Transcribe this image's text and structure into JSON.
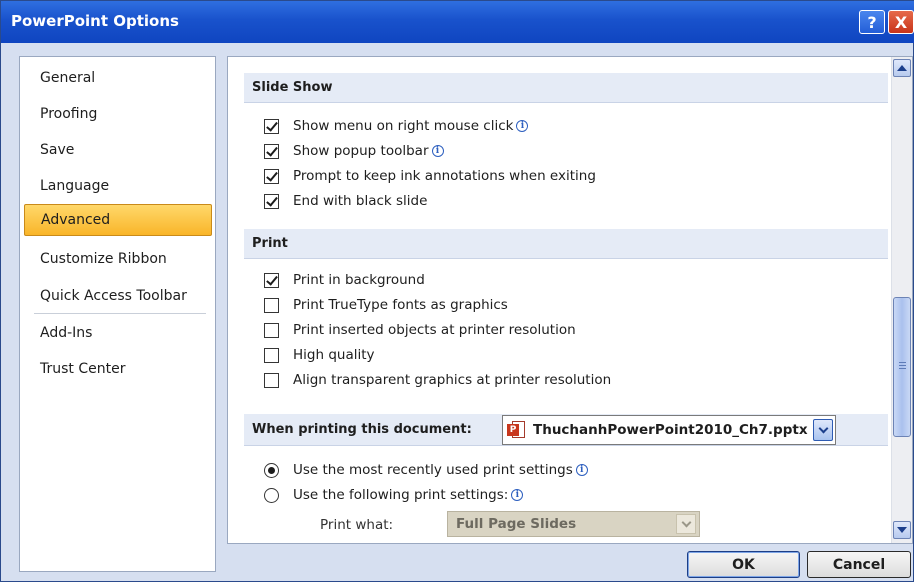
{
  "window": {
    "title": "PowerPoint Options",
    "help_label": "?",
    "close_label": "X"
  },
  "nav": {
    "items": [
      {
        "label": "General"
      },
      {
        "label": "Proofing"
      },
      {
        "label": "Save"
      },
      {
        "label": "Language"
      },
      {
        "label": "Advanced",
        "active": true
      },
      {
        "label": "Customize Ribbon"
      },
      {
        "label": "Quick Access Toolbar"
      },
      {
        "label": "Add-Ins"
      },
      {
        "label": "Trust Center"
      }
    ]
  },
  "slide_show": {
    "header": "Slide Show",
    "options": [
      {
        "label": "Show menu on right mouse click",
        "checked": true,
        "info": true
      },
      {
        "label": "Show popup toolbar",
        "checked": true,
        "info": true
      },
      {
        "label": "Prompt to keep ink annotations when exiting",
        "checked": true,
        "info": false
      },
      {
        "label": "End with black slide",
        "checked": true,
        "info": false
      }
    ]
  },
  "print": {
    "header": "Print",
    "options": [
      {
        "label": "Print in background",
        "checked": true
      },
      {
        "label": "Print TrueType fonts as graphics",
        "checked": false
      },
      {
        "label": "Print inserted objects at printer resolution",
        "checked": false
      },
      {
        "label": "High quality",
        "checked": false
      },
      {
        "label": "Align transparent graphics at printer resolution",
        "checked": false
      }
    ]
  },
  "printing_doc": {
    "header": "When printing this document:",
    "document": "ThuchanhPowerPoint2010_Ch7.pptx",
    "radios": [
      {
        "label": "Use the most recently used print settings",
        "selected": true
      },
      {
        "label": "Use the following print settings:",
        "selected": false
      }
    ],
    "print_what_label": "Print what:",
    "print_what_value": "Full Page Slides"
  },
  "buttons": {
    "ok": "OK",
    "cancel": "Cancel"
  },
  "icon_glyphs": {
    "info": "i"
  }
}
